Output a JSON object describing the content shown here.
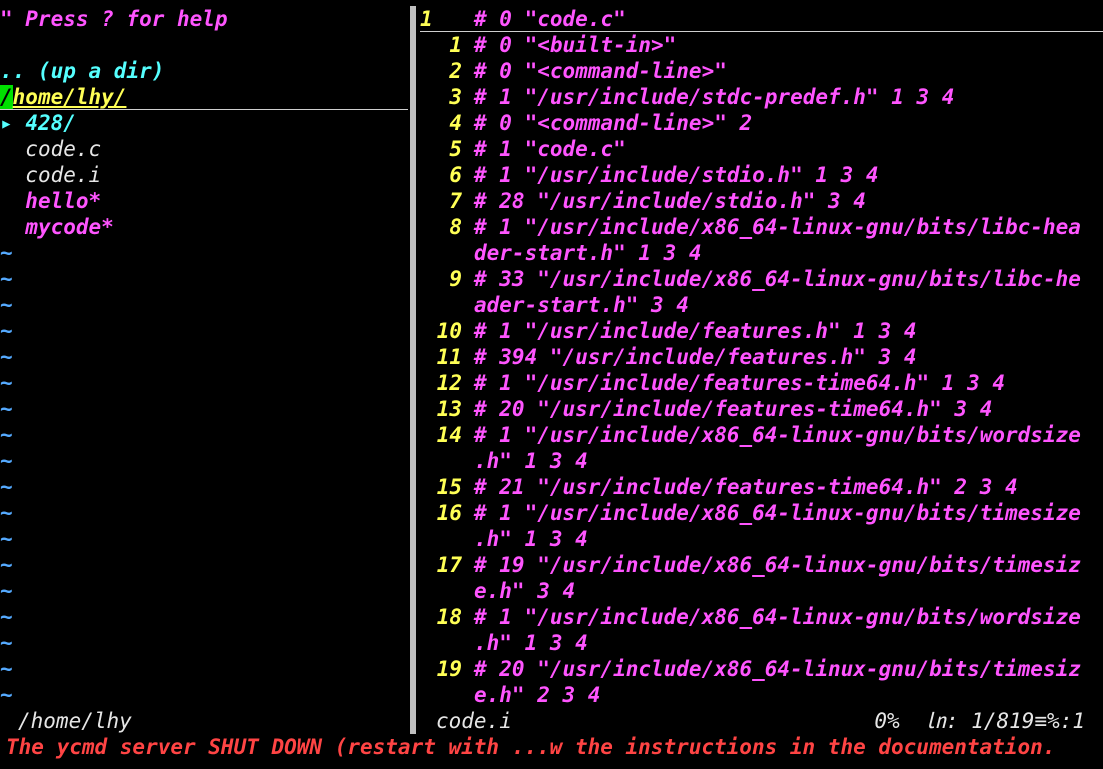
{
  "tree": {
    "help_text": "\" Press ? for help",
    "up_dir": ".. (up a dir)",
    "cwd_cursor": "/",
    "cwd_path": "home/lhy/",
    "arrow_glyph": "▸",
    "entries": [
      {
        "name": "428/",
        "kind": "dir"
      },
      {
        "name": "code.c",
        "kind": "file"
      },
      {
        "name": "code.i",
        "kind": "file"
      },
      {
        "name": "hello*",
        "kind": "exec"
      },
      {
        "name": "mycode*",
        "kind": "exec"
      }
    ],
    "tilde": "~"
  },
  "editor": {
    "cursor_line": {
      "num": "1",
      "text": "# 0 \"code.c\""
    },
    "lines": [
      {
        "num": "1",
        "text": "# 0 \"<built-in>\""
      },
      {
        "num": "2",
        "text": "# 0 \"<command-line>\""
      },
      {
        "num": "3",
        "text": "# 1 \"/usr/include/stdc-predef.h\" 1 3 4"
      },
      {
        "num": "4",
        "text": "# 0 \"<command-line>\" 2"
      },
      {
        "num": "5",
        "text": "# 1 \"code.c\""
      },
      {
        "num": "6",
        "text": "# 1 \"/usr/include/stdio.h\" 1 3 4"
      },
      {
        "num": "7",
        "text": "# 28 \"/usr/include/stdio.h\" 3 4"
      },
      {
        "num": "8",
        "text": "# 1 \"/usr/include/x86_64-linux-gnu/bits/libc-hea",
        "cont": "der-start.h\" 1 3 4"
      },
      {
        "num": "9",
        "text": "# 33 \"/usr/include/x86_64-linux-gnu/bits/libc-he",
        "cont": "ader-start.h\" 3 4"
      },
      {
        "num": "10",
        "text": "# 1 \"/usr/include/features.h\" 1 3 4"
      },
      {
        "num": "11",
        "text": "# 394 \"/usr/include/features.h\" 3 4"
      },
      {
        "num": "12",
        "text": "# 1 \"/usr/include/features-time64.h\" 1 3 4"
      },
      {
        "num": "13",
        "text": "# 20 \"/usr/include/features-time64.h\" 3 4"
      },
      {
        "num": "14",
        "text": "# 1 \"/usr/include/x86_64-linux-gnu/bits/wordsize",
        "cont": ".h\" 1 3 4"
      },
      {
        "num": "15",
        "text": "# 21 \"/usr/include/features-time64.h\" 2 3 4"
      },
      {
        "num": "16",
        "text": "# 1 \"/usr/include/x86_64-linux-gnu/bits/timesize",
        "cont": ".h\" 1 3 4"
      },
      {
        "num": "17",
        "text": "# 19 \"/usr/include/x86_64-linux-gnu/bits/timesiz",
        "cont": "e.h\" 3 4"
      },
      {
        "num": "18",
        "text": "# 1 \"/usr/include/x86_64-linux-gnu/bits/wordsize",
        "cont": ".h\" 1 3 4"
      },
      {
        "num": "19",
        "text": "# 20 \"/usr/include/x86_64-linux-gnu/bits/timesiz",
        "cont": "e.h\" 2 3 4"
      }
    ]
  },
  "status": {
    "left_path": "/home/lhy",
    "right_file": "code.i",
    "right_pos": "0%  ㏑: 1/819≡%:1"
  },
  "message": "The ycmd server SHUT DOWN (restart with ...w the instructions in the documentation.",
  "colors": {
    "background": "#000000",
    "magenta": "#ff55ff",
    "cyan": "#55ffff",
    "yellow": "#ffff55",
    "green_cursor": "#00e000",
    "tilde_blue": "#55aaff",
    "error_red": "#ff4444"
  }
}
